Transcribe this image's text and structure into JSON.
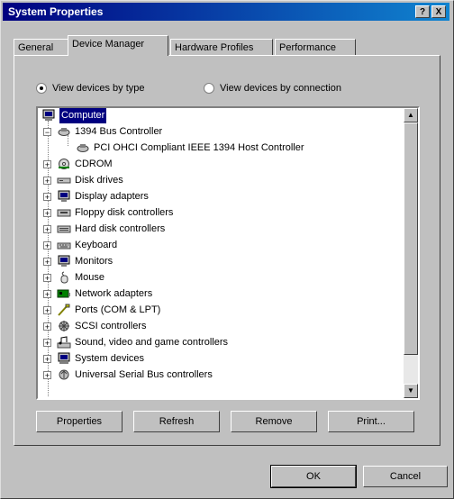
{
  "window": {
    "title": "System Properties",
    "help_label": "?",
    "close_label": "X"
  },
  "tabs": [
    {
      "label": "General"
    },
    {
      "label": "Device Manager"
    },
    {
      "label": "Hardware Profiles"
    },
    {
      "label": "Performance"
    }
  ],
  "view_options": {
    "by_type": "View devices by type",
    "by_connection": "View devices by connection",
    "selected": "by_type"
  },
  "tree": {
    "root": "Computer",
    "items": [
      {
        "label": "1394 Bus Controller",
        "expanded": true,
        "icon": "bus-controller-icon"
      },
      {
        "label": "PCI OHCI Compliant IEEE 1394 Host Controller",
        "child": true,
        "icon": "bus-controller-icon"
      },
      {
        "label": "CDROM",
        "icon": "cdrom-icon"
      },
      {
        "label": "Disk drives",
        "icon": "disk-drive-icon"
      },
      {
        "label": "Display adapters",
        "icon": "display-adapter-icon"
      },
      {
        "label": "Floppy disk controllers",
        "icon": "floppy-controller-icon"
      },
      {
        "label": "Hard disk controllers",
        "icon": "hard-disk-controller-icon"
      },
      {
        "label": "Keyboard",
        "icon": "keyboard-icon"
      },
      {
        "label": "Monitors",
        "icon": "monitor-icon"
      },
      {
        "label": "Mouse",
        "icon": "mouse-icon"
      },
      {
        "label": "Network adapters",
        "icon": "network-adapter-icon"
      },
      {
        "label": "Ports (COM & LPT)",
        "icon": "ports-icon"
      },
      {
        "label": "SCSI controllers",
        "icon": "scsi-controller-icon"
      },
      {
        "label": "Sound, video and game controllers",
        "icon": "sound-icon"
      },
      {
        "label": "System devices",
        "icon": "system-devices-icon"
      },
      {
        "label": "Universal Serial Bus controllers",
        "icon": "usb-icon"
      }
    ]
  },
  "actions": {
    "properties": "Properties",
    "refresh": "Refresh",
    "remove": "Remove",
    "print": "Print..."
  },
  "dialog": {
    "ok": "OK",
    "cancel": "Cancel"
  }
}
